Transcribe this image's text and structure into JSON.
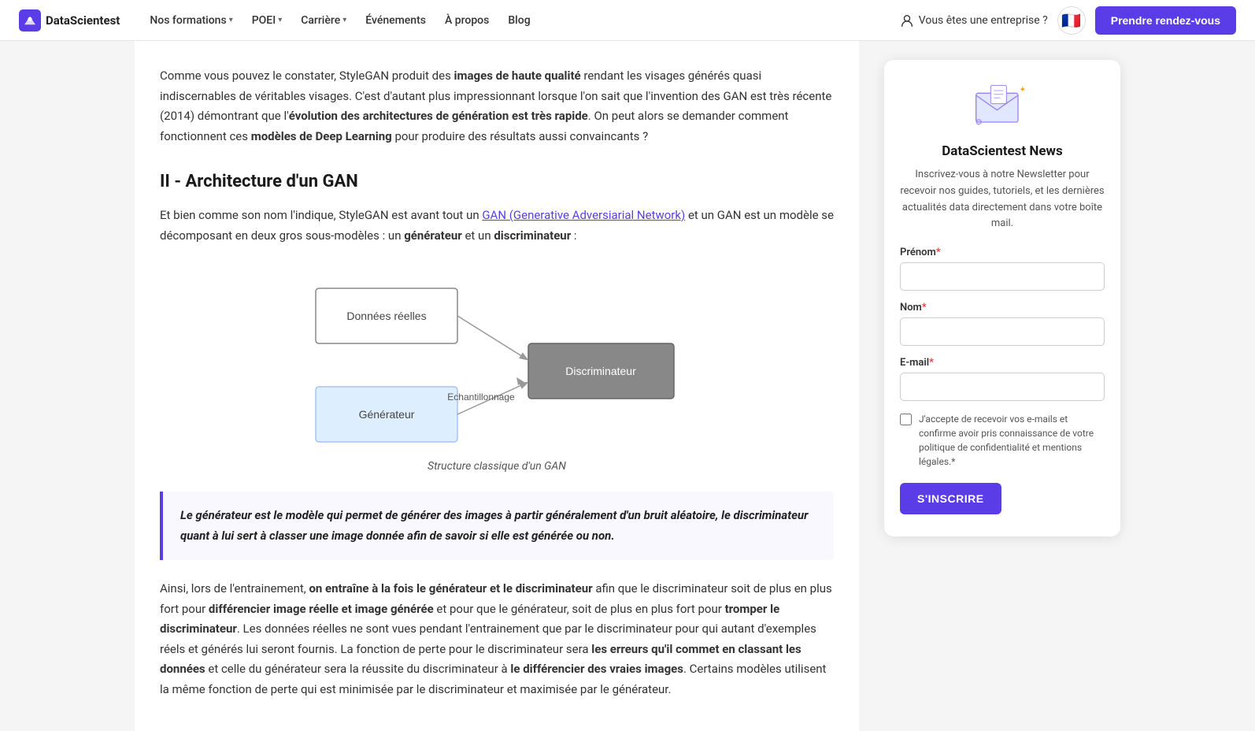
{
  "navbar": {
    "logo_text": "DataScientest",
    "nav_items": [
      {
        "label": "Nos formations",
        "has_dropdown": true
      },
      {
        "label": "POEI",
        "has_dropdown": true
      },
      {
        "label": "Carrière",
        "has_dropdown": true
      },
      {
        "label": "Événements",
        "has_dropdown": false
      },
      {
        "label": "À propos",
        "has_dropdown": false
      },
      {
        "label": "Blog",
        "has_dropdown": false
      }
    ],
    "enterprise_label": "Vous êtes une entreprise ?",
    "flag_emoji": "🇫🇷",
    "cta_label": "Prendre rendez-vous"
  },
  "article": {
    "intro_text_before": "Comme vous pouvez le constater, StyleGAN produit des ",
    "intro_bold1": "images de haute qualité",
    "intro_text2": " rendant les visages générés quasi indiscernables de véritables visages. C'est d'autant plus impressionnant lorsque l'on sait que l'invention des GAN est très récente (2014) démontrant que l'",
    "intro_bold2": "évolution des architectures de génération est très rapide",
    "intro_text3": ". On peut alors se demander comment fonctionnent ces ",
    "intro_bold3": "modèles de Deep Learning",
    "intro_text4": " pour produire des résultats aussi convaincants ?",
    "section_heading": "II - Architecture d'un GAN",
    "para1_text1": "Et bien comme son nom l'indique, StyleGAN est avant tout un ",
    "para1_link_text": "GAN (Generative Adversiarial Network)",
    "para1_text2": " et un GAN est un modèle se décomposant en deux gros sous-modèles : un ",
    "para1_bold1": "générateur",
    "para1_text3": " et un ",
    "para1_bold2": "discriminateur",
    "para1_text4": " :",
    "diagram_caption": "Structure classique d'un GAN",
    "diagram": {
      "box_donnees": "Données réelles",
      "box_generateur": "Générateur",
      "box_discriminateur": "Discriminateur",
      "arrow_label": "Echantillonnage"
    },
    "highlight": "Le générateur est le modèle qui permet de générer des images à partir généralement d'un bruit aléatoire, le discriminateur quant à lui sert à classer une image donnée afin de savoir si elle est générée ou non.",
    "body_text1": "Ainsi, lors de l'entrainement, ",
    "body_bold1": "on entraîne à la fois le générateur et le discriminateur",
    "body_text2": " afin que le discriminateur soit de plus en plus fort pour ",
    "body_bold2": "différencier image réelle et image générée",
    "body_text3": " et pour que le générateur, soit de plus en plus fort pour ",
    "body_bold3": "tromper le discriminateur",
    "body_text4": ". Les données réelles ne sont vues pendant l'entrainement que par le discriminateur pour qui autant d'exemples réels et générés lui seront fournis. La fonction de perte pour le discriminateur sera ",
    "body_bold4": "les erreurs qu'il commet en classant les données",
    "body_text5": " et celle du générateur sera la réussite du discriminateur à ",
    "body_bold5": "le différencier des vraies images",
    "body_text6": ". Certains modèles utilisent la même fonction de perte qui est minimisée par le discriminateur et maximisée par le générateur."
  },
  "sidebar": {
    "title": "DataScientest News",
    "description": "Inscrivez-vous à notre Newsletter pour recevoir nos guides, tutoriels, et les dernières actualités data directement dans votre boîte mail.",
    "prenom_label": "Prénom",
    "prenom_required": "*",
    "nom_label": "Nom",
    "nom_required": "*",
    "email_label": "E-mail",
    "email_required": "*",
    "checkbox_text": "J'accepte de recevoir vos e-mails et confirme avoir pris connaissance de votre politique de confidentialité et mentions légales.",
    "checkbox_required": "*",
    "subscribe_btn": "S'INSCRIRE"
  }
}
